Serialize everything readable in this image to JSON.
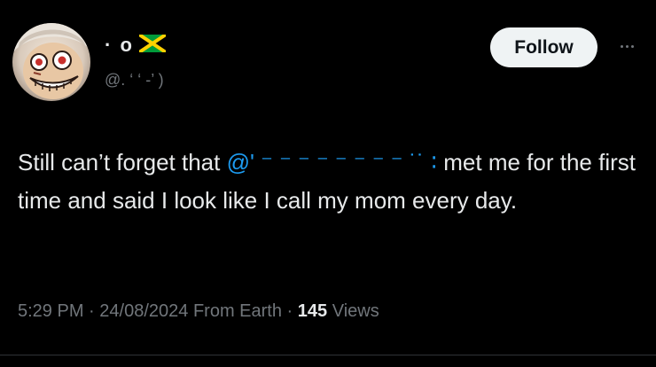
{
  "author": {
    "display_name": "· o",
    "handle": "@. ‘ ‘ -’ )",
    "flag_icon": "jamaica-flag-icon",
    "avatar_icon": "avatar-image"
  },
  "actions": {
    "follow_label": "Follow",
    "more_icon": "more-options-icon"
  },
  "tweet": {
    "text_before": "Still can’t forget that ",
    "mention": "@' ⁻ ⁻ ⁻ ⁻ ⁻ ⁻ ⁻ ⁻ ˙˙ ∶",
    "text_after": " met me for the first time and said I look like I call my mom every day."
  },
  "meta": {
    "time": "5:29 PM",
    "date": "24/08/2024",
    "location": "From Earth",
    "views_count": "145",
    "views_label": "Views",
    "separator": "·"
  },
  "colors": {
    "background": "#000000",
    "text": "#e7e9ea",
    "secondary": "#71767b",
    "accent": "#1d9bf0",
    "follow_bg": "#eff3f4"
  }
}
